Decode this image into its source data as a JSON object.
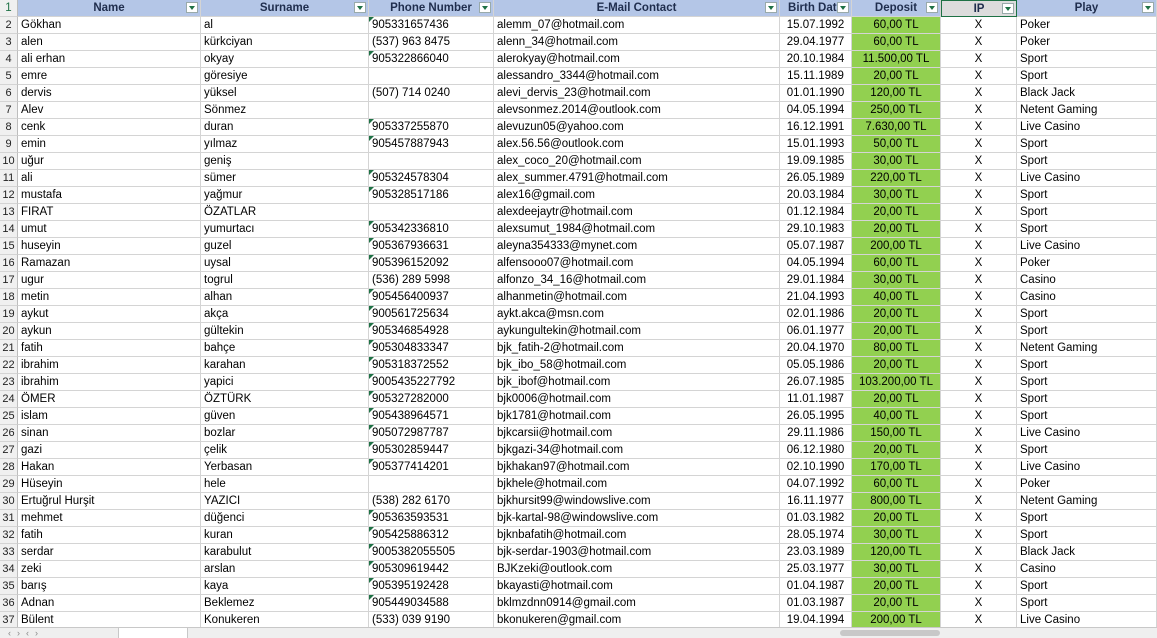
{
  "headers": {
    "rownum": "1",
    "name": "Name",
    "surname": "Surname",
    "phone": "Phone Number",
    "email": "E-Mail Contact",
    "birth": "Birth Date",
    "deposit": "Deposit",
    "ip": "IP",
    "play": "Play"
  },
  "rows": [
    {
      "n": "2",
      "name": "Gökhan",
      "surname": "al",
      "phone": "905331657436",
      "email": "alemm_07@hotmail.com",
      "birth": "15.07.1992",
      "deposit": "60,00 TL",
      "ip": "X",
      "play": "Poker"
    },
    {
      "n": "3",
      "name": "alen",
      "surname": "kürkciyan",
      "phone": "(537) 963 8475",
      "email": "alenn_34@hotmail.com",
      "birth": "29.04.1977",
      "deposit": "60,00 TL",
      "ip": "X",
      "play": "Poker"
    },
    {
      "n": "4",
      "name": "ali erhan",
      "surname": "okyay",
      "phone": "905322866040",
      "email": "alerokyay@hotmail.com",
      "birth": "20.10.1984",
      "deposit": "11.500,00 TL",
      "ip": "X",
      "play": "Sport"
    },
    {
      "n": "5",
      "name": "emre",
      "surname": "göresiye",
      "phone": "",
      "email": "alessandro_3344@hotmail.com",
      "birth": "15.11.1989",
      "deposit": "20,00 TL",
      "ip": "X",
      "play": "Sport"
    },
    {
      "n": "6",
      "name": "dervis",
      "surname": "yüksel",
      "phone": "(507) 714 0240",
      "email": "alevi_dervis_23@hotmail.com",
      "birth": "01.01.1990",
      "deposit": "120,00 TL",
      "ip": "X",
      "play": "Black Jack"
    },
    {
      "n": "7",
      "name": "Alev",
      "surname": "Sönmez",
      "phone": "",
      "email": "alevsonmez.2014@outlook.com",
      "birth": "04.05.1994",
      "deposit": "250,00 TL",
      "ip": "X",
      "play": "Netent Gaming"
    },
    {
      "n": "8",
      "name": "cenk",
      "surname": "duran",
      "phone": "905337255870",
      "email": "alevuzun05@yahoo.com",
      "birth": "16.12.1991",
      "deposit": "7.630,00 TL",
      "ip": "X",
      "play": "Live Casino"
    },
    {
      "n": "9",
      "name": "emin",
      "surname": "yılmaz",
      "phone": "905457887943",
      "email": "alex.56.56@outlook.com",
      "birth": "15.01.1993",
      "deposit": "50,00 TL",
      "ip": "X",
      "play": "Sport"
    },
    {
      "n": "10",
      "name": "uğur",
      "surname": "geniş",
      "phone": "",
      "email": "alex_coco_20@hotmail.com",
      "birth": "19.09.1985",
      "deposit": "30,00 TL",
      "ip": "X",
      "play": "Sport"
    },
    {
      "n": "11",
      "name": "ali",
      "surname": "sümer",
      "phone": "905324578304",
      "email": "alex_summer.4791@hotmail.com",
      "birth": "26.05.1989",
      "deposit": "220,00 TL",
      "ip": "X",
      "play": "Live Casino"
    },
    {
      "n": "12",
      "name": "mustafa",
      "surname": "yağmur",
      "phone": "905328517186",
      "email": "alex16@gmail.com",
      "birth": "20.03.1984",
      "deposit": "30,00 TL",
      "ip": "X",
      "play": "Sport"
    },
    {
      "n": "13",
      "name": "FIRAT",
      "surname": "ÖZATLAR",
      "phone": "",
      "email": "alexdeejaytr@hotmail.com",
      "birth": "01.12.1984",
      "deposit": "20,00 TL",
      "ip": "X",
      "play": "Sport"
    },
    {
      "n": "14",
      "name": "umut",
      "surname": "yumurtacı",
      "phone": "905342336810",
      "email": "alexsumut_1984@hotmail.com",
      "birth": "29.10.1983",
      "deposit": "20,00 TL",
      "ip": "X",
      "play": "Sport"
    },
    {
      "n": "15",
      "name": "huseyin",
      "surname": "guzel",
      "phone": "905367936631",
      "email": "aleyna354333@mynet.com",
      "birth": "05.07.1987",
      "deposit": "200,00 TL",
      "ip": "X",
      "play": "Live Casino"
    },
    {
      "n": "16",
      "name": "Ramazan",
      "surname": "uysal",
      "phone": "905396152092",
      "email": "alfensooo07@hotmail.com",
      "birth": "04.05.1994",
      "deposit": "60,00 TL",
      "ip": "X",
      "play": "Poker"
    },
    {
      "n": "17",
      "name": "ugur",
      "surname": "togrul",
      "phone": "(536) 289 5998",
      "email": "alfonzo_34_16@hotmail.com",
      "birth": "29.01.1984",
      "deposit": "30,00 TL",
      "ip": "X",
      "play": "Casino"
    },
    {
      "n": "18",
      "name": "metin",
      "surname": "alhan",
      "phone": "905456400937",
      "email": "alhanmetin@hotmail.com",
      "birth": "21.04.1993",
      "deposit": "40,00 TL",
      "ip": "X",
      "play": "Casino"
    },
    {
      "n": "19",
      "name": "aykut",
      "surname": "akça",
      "phone": "900561725634",
      "email": "aykt.akca@msn.com",
      "birth": "02.01.1986",
      "deposit": "20,00 TL",
      "ip": "X",
      "play": "Sport"
    },
    {
      "n": "20",
      "name": "aykun",
      "surname": "gültekin",
      "phone": "905346854928",
      "email": "aykungultekin@hotmail.com",
      "birth": "06.01.1977",
      "deposit": "20,00 TL",
      "ip": "X",
      "play": "Sport"
    },
    {
      "n": "21",
      "name": "fatih",
      "surname": "bahçe",
      "phone": "905304833347",
      "email": "bjk_fatih-2@hotmail.com",
      "birth": "20.04.1970",
      "deposit": "80,00 TL",
      "ip": "X",
      "play": "Netent Gaming"
    },
    {
      "n": "22",
      "name": "ibrahim",
      "surname": "karahan",
      "phone": "905318372552",
      "email": "bjk_ibo_58@hotmail.com",
      "birth": "05.05.1986",
      "deposit": "20,00 TL",
      "ip": "X",
      "play": "Sport"
    },
    {
      "n": "23",
      "name": "ibrahim",
      "surname": "yapici",
      "phone": "9005435227792",
      "email": "bjk_ibof@hotmail.com",
      "birth": "26.07.1985",
      "deposit": "103.200,00 TL",
      "ip": "X",
      "play": "Sport"
    },
    {
      "n": "24",
      "name": "ÖMER",
      "surname": "ÖZTÜRK",
      "phone": "905327282000",
      "email": "bjk0006@hotmail.com",
      "birth": "11.01.1987",
      "deposit": "20,00 TL",
      "ip": "X",
      "play": "Sport"
    },
    {
      "n": "25",
      "name": "islam",
      "surname": "güven",
      "phone": "905438964571",
      "email": "bjk1781@hotmail.com",
      "birth": "26.05.1995",
      "deposit": "40,00 TL",
      "ip": "X",
      "play": "Sport"
    },
    {
      "n": "26",
      "name": "sinan",
      "surname": "bozlar",
      "phone": "905072987787",
      "email": "bjkcarsii@hotmail.com",
      "birth": "29.11.1986",
      "deposit": "150,00 TL",
      "ip": "X",
      "play": "Live Casino"
    },
    {
      "n": "27",
      "name": "gazi",
      "surname": "çelik",
      "phone": "905302859447",
      "email": "bjkgazi-34@hotmail.com",
      "birth": "06.12.1980",
      "deposit": "20,00 TL",
      "ip": "X",
      "play": "Sport"
    },
    {
      "n": "28",
      "name": "Hakan",
      "surname": "Yerbasan",
      "phone": "905377414201",
      "email": "bjkhakan97@hotmail.com",
      "birth": "02.10.1990",
      "deposit": "170,00 TL",
      "ip": "X",
      "play": "Live Casino"
    },
    {
      "n": "29",
      "name": "Hüseyin",
      "surname": "hele",
      "phone": "",
      "email": "bjkhele@hotmail.com",
      "birth": "04.07.1992",
      "deposit": "60,00 TL",
      "ip": "X",
      "play": "Poker"
    },
    {
      "n": "30",
      "name": "Ertuğrul Hurşit",
      "surname": "YAZICI",
      "phone": "(538) 282 6170",
      "email": "bjkhursit99@windowslive.com",
      "birth": "16.11.1977",
      "deposit": "800,00 TL",
      "ip": "X",
      "play": "Netent Gaming"
    },
    {
      "n": "31",
      "name": "mehmet",
      "surname": "düğenci",
      "phone": "905363593531",
      "email": "bjk-kartal-98@windowslive.com",
      "birth": "01.03.1982",
      "deposit": "20,00 TL",
      "ip": "X",
      "play": "Sport"
    },
    {
      "n": "32",
      "name": "fatih",
      "surname": "kuran",
      "phone": "905425886312",
      "email": "bjknbafatih@hotmail.com",
      "birth": "28.05.1974",
      "deposit": "30,00 TL",
      "ip": "X",
      "play": "Sport"
    },
    {
      "n": "33",
      "name": "serdar",
      "surname": "karabulut",
      "phone": "9005382055505",
      "email": "bjk-serdar-1903@hotmail.com",
      "birth": "23.03.1989",
      "deposit": "120,00 TL",
      "ip": "X",
      "play": "Black Jack"
    },
    {
      "n": "34",
      "name": "zeki",
      "surname": "arslan",
      "phone": "905309619442",
      "email": "BJKzeki@outlook.com",
      "birth": "25.03.1977",
      "deposit": "30,00 TL",
      "ip": "X",
      "play": "Casino"
    },
    {
      "n": "35",
      "name": "barış",
      "surname": "kaya",
      "phone": "905395192428",
      "email": "bkayasti@hotmail.com",
      "birth": "01.04.1987",
      "deposit": "20,00 TL",
      "ip": "X",
      "play": "Sport"
    },
    {
      "n": "36",
      "name": "Adnan",
      "surname": "Beklemez",
      "phone": "905449034588",
      "email": "bklmzdnn0914@gmail.com",
      "birth": "01.03.1987",
      "deposit": "20,00 TL",
      "ip": "X",
      "play": "Sport"
    },
    {
      "n": "37",
      "name": "Bülent",
      "surname": "Konukeren",
      "phone": "(533) 039 9190",
      "email": "bkonukeren@gmail.com",
      "birth": "19.04.1994",
      "deposit": "200,00 TL",
      "ip": "X",
      "play": "Live Casino"
    }
  ],
  "colors": {
    "header": "#b4c6e7",
    "deposit": "#92d050",
    "excel_green": "#1e7145"
  }
}
